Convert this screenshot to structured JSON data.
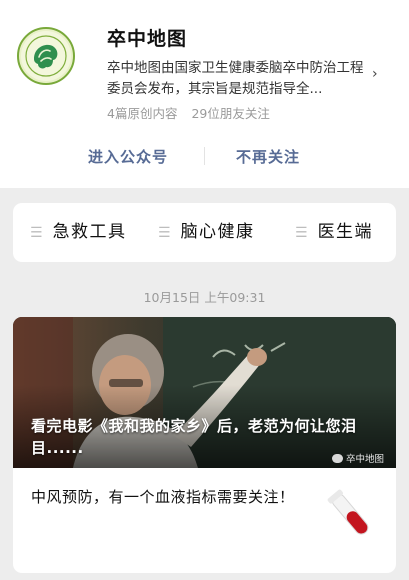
{
  "profile": {
    "name": "卒中地图",
    "description": "卒中地图由国家卫生健康委脑卒中防治工程委员会发布，其宗旨是规范指导全...",
    "original_count": "4篇原创内容",
    "followers": "29位朋友关注",
    "enter_label": "进入公众号",
    "unfollow_label": "不再关注",
    "arrow": "›"
  },
  "menu": {
    "items": [
      {
        "label": "急救工具"
      },
      {
        "label": "脑心健康"
      },
      {
        "label": "医生端"
      }
    ]
  },
  "timestamp": "10月15日 上午09:31",
  "articles": [
    {
      "title": "看完电影《我和我的家乡》后，老范为何让您泪目......",
      "source": "卒中地图"
    },
    {
      "title": "中风预防，有一个血液指标需要关注！"
    }
  ],
  "colors": {
    "link": "#576b95",
    "background": "#ededed",
    "logo_green": "#79a93a",
    "blood_red": "#c3151f"
  }
}
